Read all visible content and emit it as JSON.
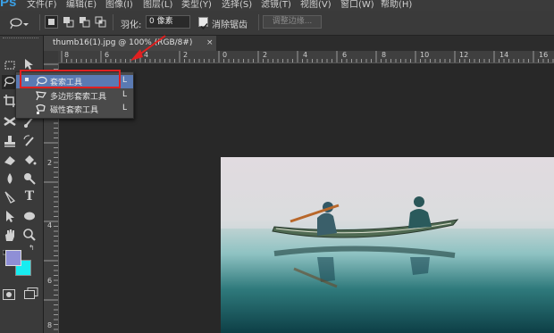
{
  "app": {
    "logo": "Ps"
  },
  "menubar": {
    "items": [
      "文件(F)",
      "编辑(E)",
      "图像(I)",
      "图层(L)",
      "类型(Y)",
      "选择(S)",
      "滤镜(T)",
      "视图(V)",
      "窗口(W)",
      "帮助(H)"
    ]
  },
  "options": {
    "feather_label": "羽化:",
    "feather_value": "0 像素",
    "antialias_label": "消除锯齿",
    "antialias_checked": true,
    "refine_edge_label": "调整边缘..."
  },
  "document": {
    "tab_title": "thumb16(1).jpg @ 100% (RGB/8#)",
    "tab_close": "×"
  },
  "ruler_top": {
    "labels": [
      "8",
      "6",
      "4",
      "2",
      "0",
      "2",
      "4",
      "6",
      "8",
      "10",
      "12",
      "14",
      "16"
    ]
  },
  "ruler_left": {
    "labels": [
      "0",
      "2",
      "4",
      "6",
      "8"
    ]
  },
  "flyout": {
    "items": [
      {
        "label": "套索工具",
        "key": "L",
        "icon": "lasso-icon",
        "active": true
      },
      {
        "label": "多边形套索工具",
        "key": "L",
        "icon": "polygonal-lasso-icon",
        "active": false
      },
      {
        "label": "磁性套索工具",
        "key": "L",
        "icon": "magnetic-lasso-icon",
        "active": false
      }
    ]
  },
  "colors": {
    "foreground": "#8f8fd6",
    "background": "#18ecf0",
    "highlight_box": "#e02020",
    "annotation_arrow": "#e02020"
  }
}
